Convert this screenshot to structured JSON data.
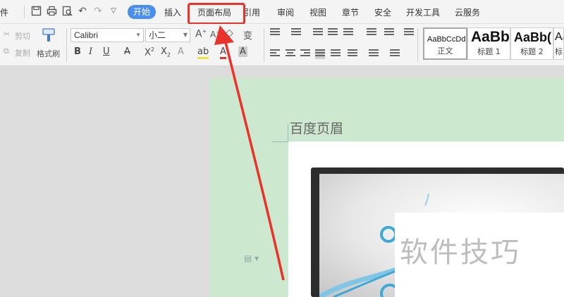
{
  "menu": {
    "file_partial": "件",
    "tabs": [
      "开始",
      "插入",
      "页面布局",
      "引用",
      "审阅",
      "视图",
      "章节",
      "安全",
      "开发工具",
      "云服务"
    ]
  },
  "ribbon": {
    "cut_label": "剪切",
    "copy_label": "复制",
    "format_painter_label": "格式刷",
    "font_name": "Calibri",
    "font_size": "小二",
    "styles": [
      {
        "sample": "AaBbCcDd",
        "name": "正文"
      },
      {
        "sample": "AaBb",
        "name": "标题 1"
      },
      {
        "sample": "AaBb(",
        "name": "标题 2"
      },
      {
        "sample": "Aa",
        "name": "标"
      }
    ]
  },
  "document": {
    "header_text": "百度页眉",
    "watermark": "软件技巧"
  },
  "colors": {
    "accent": "#4a8ff0",
    "highlight": "#e8322a",
    "page_bg": "#cce8cf"
  }
}
